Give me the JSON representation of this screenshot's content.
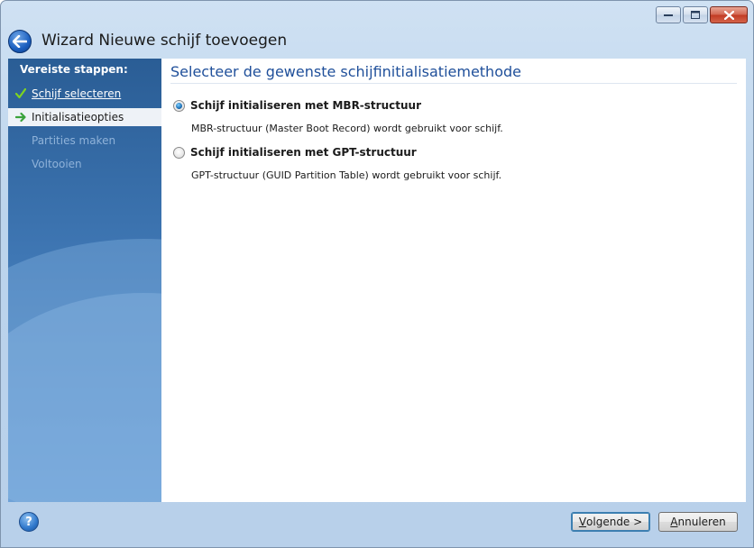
{
  "window": {
    "title": "Wizard Nieuwe schijf toevoegen"
  },
  "sidebar": {
    "header": "Vereiste stappen:",
    "steps": [
      {
        "label": "Schijf selecteren",
        "state": "done"
      },
      {
        "label": "Initialisatieopties",
        "state": "current"
      },
      {
        "label": "Partities maken",
        "state": "pending"
      },
      {
        "label": "Voltooien",
        "state": "pending"
      }
    ]
  },
  "main": {
    "title": "Selecteer de gewenste schijfinitialisatiemethode",
    "options": [
      {
        "label": "Schijf initialiseren met MBR-structuur",
        "description": "MBR-structuur (Master Boot Record) wordt gebruikt voor schijf.",
        "checked": true
      },
      {
        "label": "Schijf initialiseren met GPT-structuur",
        "description": "GPT-structuur (GUID Partition Table) wordt gebruikt voor schijf.",
        "checked": false
      }
    ]
  },
  "footer": {
    "next_accel": "V",
    "next_rest": "olgende >",
    "cancel_accel": "A",
    "cancel_rest": "nnuleren"
  },
  "icons": {
    "back": "back-arrow-icon",
    "help": "help-icon",
    "done": "checkmark-icon",
    "current": "arrow-right-icon"
  },
  "colors": {
    "accent_title": "#1f4f9a",
    "sidebar_top": "#2a5d95",
    "sidebar_bottom": "#5b92cd",
    "step_done_check": "#7ed321",
    "step_current_arrow": "#3ba33b"
  }
}
